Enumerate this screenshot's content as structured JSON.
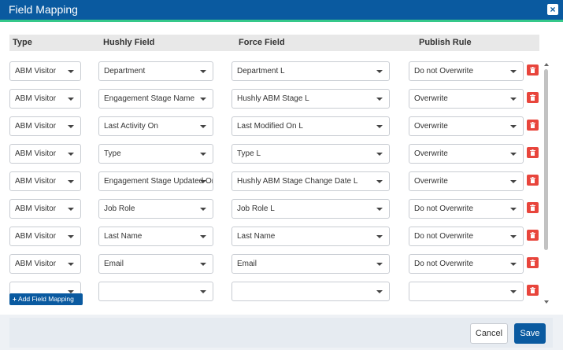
{
  "window": {
    "title": "Field Mapping",
    "close_label": "×"
  },
  "table": {
    "headers": [
      "Type",
      "Hushly Field",
      "Force Field",
      "Publish Rule"
    ],
    "rows": [
      {
        "type": "ABM Visitor",
        "hushly_field": "Department",
        "force_field": "Department L",
        "publish_rule": "Do not Overwrite"
      },
      {
        "type": "ABM Visitor",
        "hushly_field": "Engagement Stage Name",
        "force_field": "Hushly ABM Stage L",
        "publish_rule": "Overwrite"
      },
      {
        "type": "ABM Visitor",
        "hushly_field": "Last Activity On",
        "force_field": "Last Modified On L",
        "publish_rule": "Overwrite"
      },
      {
        "type": "ABM Visitor",
        "hushly_field": "Type",
        "force_field": "Type L",
        "publish_rule": "Overwrite"
      },
      {
        "type": "ABM Visitor",
        "hushly_field": "Engagement Stage Updated On",
        "force_field": "Hushly ABM Stage Change Date L",
        "publish_rule": "Overwrite"
      },
      {
        "type": "ABM Visitor",
        "hushly_field": "Job Role",
        "force_field": "Job Role L",
        "publish_rule": "Do not Overwrite"
      },
      {
        "type": "ABM Visitor",
        "hushly_field": "Last Name",
        "force_field": "Last Name",
        "publish_rule": "Do not Overwrite"
      },
      {
        "type": "ABM Visitor",
        "hushly_field": "Email",
        "force_field": "Email",
        "publish_rule": "Do not Overwrite"
      },
      {
        "type": "",
        "hushly_field": "",
        "force_field": "",
        "publish_rule": ""
      }
    ]
  },
  "actions": {
    "add_mapping_label": "Add Field Mapping",
    "cancel_label": "Cancel",
    "save_label": "Save"
  },
  "icons": {
    "close": "close-icon",
    "add": "plus-icon",
    "delete": "trash-icon",
    "dropdown": "chevron-down-icon"
  },
  "colors": {
    "header_blue": "#0a5aa0",
    "accent_green": "#35c88a",
    "delete_red": "#e8453c"
  }
}
